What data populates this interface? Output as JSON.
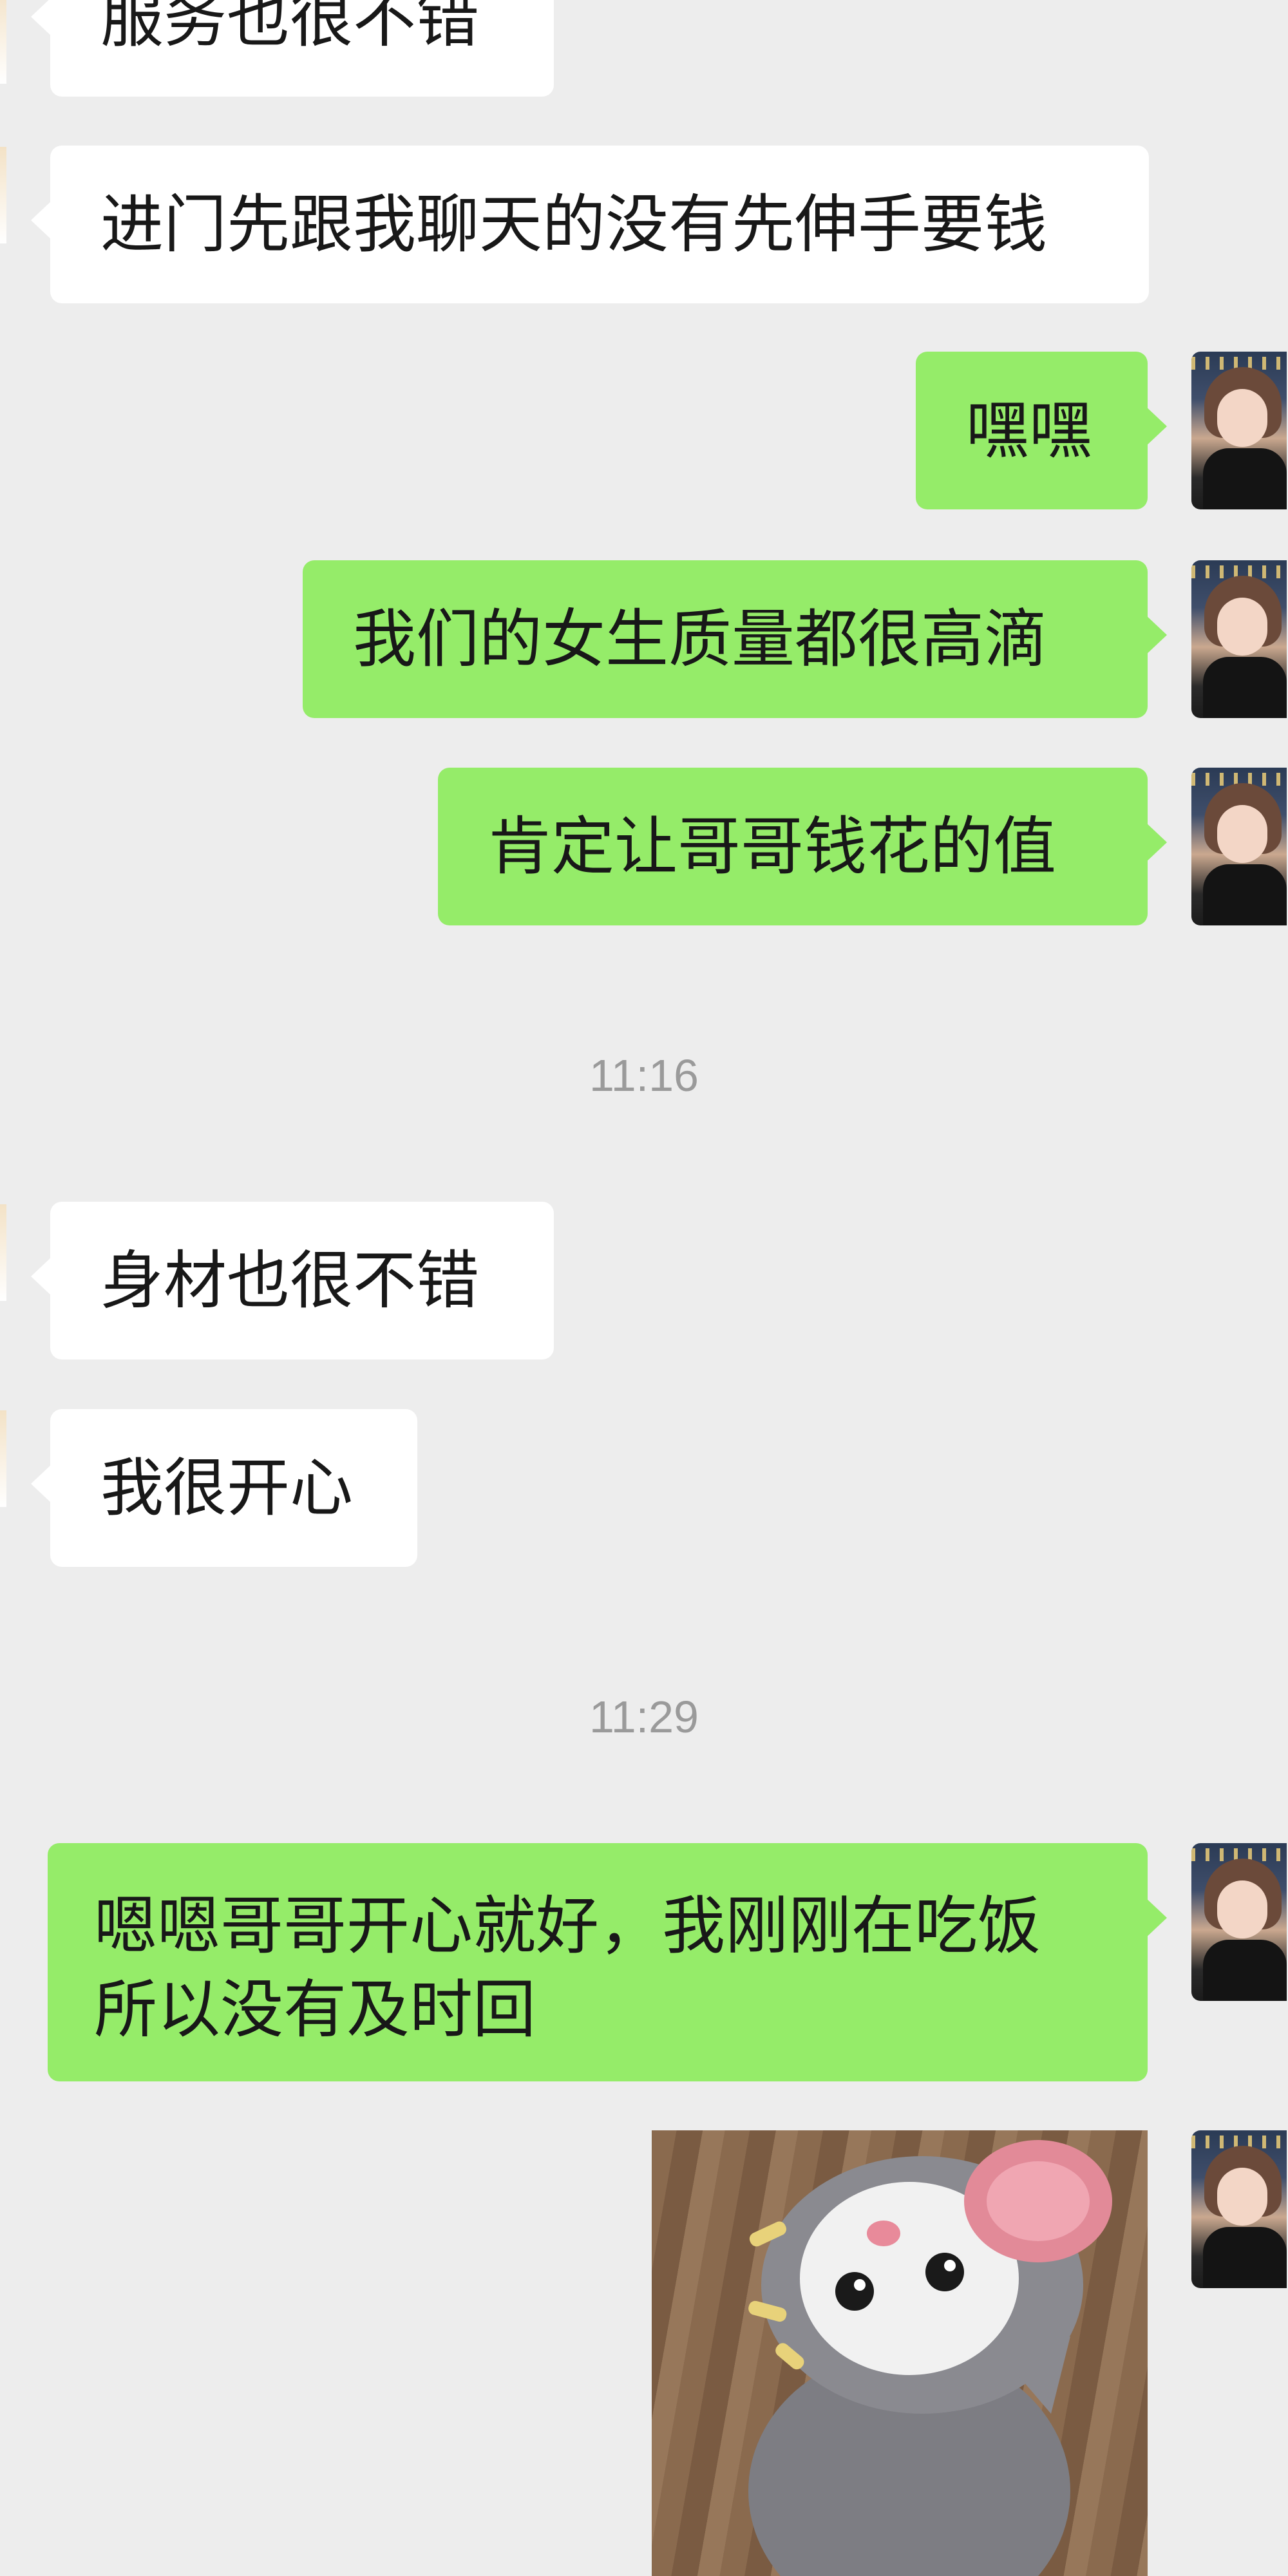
{
  "messages": {
    "m1": "服务也很不错",
    "m2": "进门先跟我聊天的没有先伸手要钱",
    "m3": "嘿嘿",
    "m4": "我们的女生质量都很高滴",
    "m5": "肯定让哥哥钱花的值",
    "m6": "身材也很不错",
    "m7": "我很开心",
    "m8": "嗯嗯哥哥开心就好，我刚刚在吃饭所以没有及时回"
  },
  "timestamps": {
    "t1": "11:16",
    "t2": "11:29"
  },
  "colors": {
    "background": "#ededed",
    "incoming_bubble": "#ffffff",
    "outgoing_bubble": "#95ec69",
    "timestamp_text": "#9a9a9a"
  },
  "icons": {
    "avatar": "user-avatar-photo",
    "image_message": "cat-photo"
  }
}
